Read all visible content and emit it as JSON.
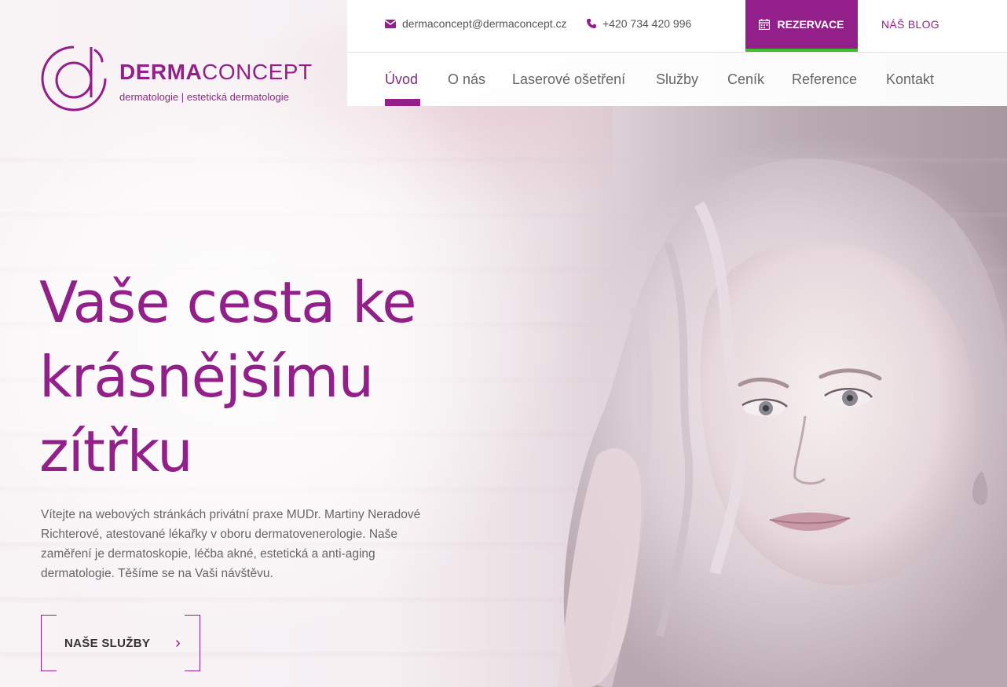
{
  "brand": {
    "name_bold": "DERMA",
    "name_light": "CONCEPT",
    "tagline": "dermatologie | estetická dermatologie",
    "accent_color": "#93208a",
    "highlight_color": "#3fbf2c"
  },
  "topbar": {
    "email": "dermaconcept@dermaconcept.cz",
    "email_icon": "envelope-icon",
    "phone": "+420 734 420 996",
    "phone_icon": "phone-icon",
    "reservation_label": "REZERVACE",
    "reservation_icon": "calendar-icon",
    "blog_label": "NÁŠ BLOG"
  },
  "nav": {
    "items": [
      {
        "label": "Úvod",
        "active": true
      },
      {
        "label": "O nás",
        "active": false
      },
      {
        "label": "Laserové ošetření",
        "active": false
      },
      {
        "label": "Služby",
        "active": false
      },
      {
        "label": "Ceník",
        "active": false
      },
      {
        "label": "Reference",
        "active": false
      },
      {
        "label": "Kontakt",
        "active": false
      }
    ]
  },
  "hero": {
    "title_lines": [
      "Vaše cesta ke",
      "krásnějšímu",
      "zítřku"
    ],
    "text": "Vítejte na webových stránkách privátní praxe MUDr. Martiny Neradové Richterové, atestované lékařky v oboru dermatovenerologie. Naše zaměření je dermatoskopie, léčba akné, estetická a anti-aging dermatologie. Těšíme se na Vaši návštěvu.",
    "button_label": "NAŠE SLUŽBY",
    "button_icon": "chevron-right-icon"
  }
}
